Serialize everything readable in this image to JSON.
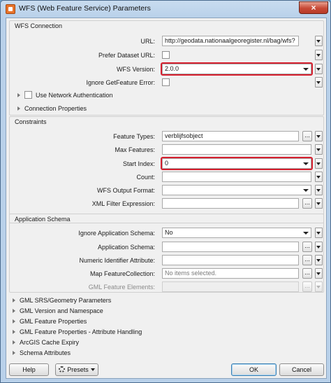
{
  "window": {
    "title": "WFS (Web Feature Service) Parameters",
    "close_symbol": "×"
  },
  "wfs_connection": {
    "section_title": "WFS Connection",
    "url_label": "URL:",
    "url_value": "http://geodata.nationaalgeoregister.nl/bag/wfs?",
    "prefer_dataset_url_label": "Prefer Dataset URL:",
    "wfs_version_label": "WFS Version:",
    "wfs_version_value": "2.0.0",
    "ignore_getfeature_error_label": "Ignore GetFeature Error:",
    "use_network_auth_label": "Use Network Authentication",
    "connection_properties_label": "Connection Properties"
  },
  "constraints": {
    "section_title": "Constraints",
    "feature_types_label": "Feature Types:",
    "feature_types_value": "verblijfsobject",
    "max_features_label": "Max Features:",
    "max_features_value": "",
    "start_index_label": "Start Index:",
    "start_index_value": "0",
    "count_label": "Count:",
    "count_value": "",
    "wfs_output_format_label": "WFS Output Format:",
    "wfs_output_format_value": "",
    "xml_filter_expression_label": "XML Filter Expression:",
    "xml_filter_expression_value": ""
  },
  "application_schema": {
    "section_title": "Application Schema",
    "ignore_app_schema_label": "Ignore Application Schema:",
    "ignore_app_schema_value": "No",
    "app_schema_label": "Application Schema:",
    "app_schema_value": "",
    "numeric_identifier_label": "Numeric Identifier Attribute:",
    "numeric_identifier_value": "",
    "map_feature_collection_label": "Map FeatureCollection:",
    "map_feature_collection_value": "No items selected.",
    "gml_feature_elements_label": "GML Feature Elements:",
    "gml_feature_elements_value": ""
  },
  "collapsed_groups": [
    "GML SRS/Geometry Parameters",
    "GML Version and Namespace",
    "GML Feature Properties",
    "GML Feature Properties - Attribute Handling",
    "ArcGIS Cache Expiry",
    "Schema Attributes"
  ],
  "buttons": {
    "ellipsis": "...",
    "help": "Help",
    "presets": "Presets",
    "ok": "OK",
    "cancel": "Cancel"
  },
  "colors": {
    "highlight": "#d6202f",
    "title_bar": "#b9d1ea",
    "dialog_bg": "#f0f0f0"
  }
}
